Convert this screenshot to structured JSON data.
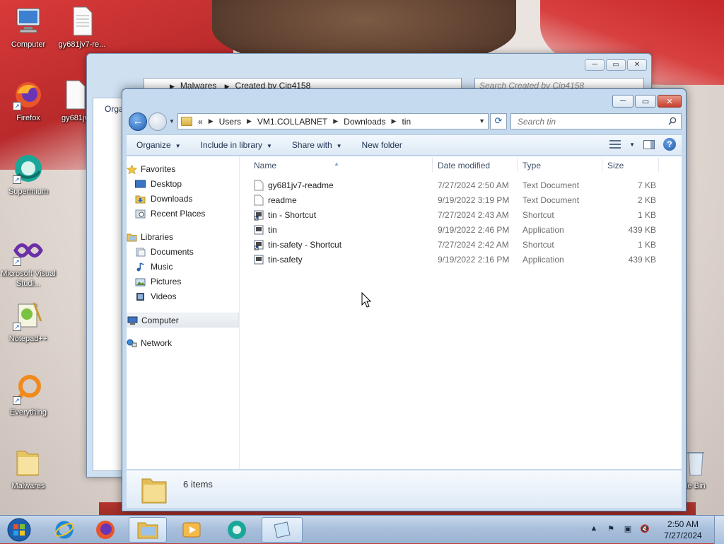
{
  "desktop": {
    "icons": [
      {
        "name": "computer",
        "label": "Computer"
      },
      {
        "name": "gy681jv7-readme-file",
        "label": "gy681jv7-re..."
      },
      {
        "name": "firefox",
        "label": "Firefox"
      },
      {
        "name": "gy681jv-file",
        "label": "gy681jv"
      },
      {
        "name": "supermium",
        "label": "Supermium"
      },
      {
        "name": "visual-studio",
        "label": "Microsoft Visual Studi..."
      },
      {
        "name": "notepadpp",
        "label": "Notepad++"
      },
      {
        "name": "everything",
        "label": "Everything"
      },
      {
        "name": "malwares-folder",
        "label": "Malwares"
      },
      {
        "name": "recycle-bin",
        "label": "cle Bin"
      }
    ]
  },
  "back_window": {
    "breadcrumb": [
      "Malwares",
      "Created by Cip4158"
    ],
    "search_placeholder": "Search Created by Cip4158",
    "organize_partial": "Orga"
  },
  "window": {
    "breadcrumb": {
      "prefix": "«",
      "parts": [
        "Users",
        "VM1.COLLABNET",
        "Downloads",
        "tin"
      ]
    },
    "search_placeholder": "Search tin",
    "toolbar": {
      "organize": "Organize",
      "include_in_library": "Include in library",
      "share_with": "Share with",
      "new_folder": "New folder"
    },
    "nav": {
      "favorites": "Favorites",
      "desktop": "Desktop",
      "downloads": "Downloads",
      "recent_places": "Recent Places",
      "libraries": "Libraries",
      "documents": "Documents",
      "music": "Music",
      "pictures": "Pictures",
      "videos": "Videos",
      "computer": "Computer",
      "network": "Network"
    },
    "columns": {
      "name": "Name",
      "date_modified": "Date modified",
      "type": "Type",
      "size": "Size"
    },
    "files": [
      {
        "name": "gy681jv7-readme",
        "date": "7/27/2024 2:50 AM",
        "type": "Text Document",
        "size": "7 KB",
        "icon": "text-file-icon"
      },
      {
        "name": "readme",
        "date": "9/19/2022 3:19 PM",
        "type": "Text Document",
        "size": "2 KB",
        "icon": "text-file-icon"
      },
      {
        "name": "tin - Shortcut",
        "date": "7/27/2024 2:43 AM",
        "type": "Shortcut",
        "size": "1 KB",
        "icon": "shortcut-icon"
      },
      {
        "name": "tin",
        "date": "9/19/2022 2:46 PM",
        "type": "Application",
        "size": "439 KB",
        "icon": "application-icon"
      },
      {
        "name": "tin-safety - Shortcut",
        "date": "7/27/2024 2:42 AM",
        "type": "Shortcut",
        "size": "1 KB",
        "icon": "shortcut-icon"
      },
      {
        "name": "tin-safety",
        "date": "9/19/2022 2:16 PM",
        "type": "Application",
        "size": "439 KB",
        "icon": "application-icon"
      }
    ],
    "status": {
      "item_count": "6 items"
    }
  },
  "taskbar": {
    "clock_time": "2:50 AM",
    "clock_date": "7/27/2024"
  },
  "colors": {
    "accent": "#1e5fb4",
    "window_frame": "#c5daee",
    "taskbar": "#a9c0dc"
  }
}
